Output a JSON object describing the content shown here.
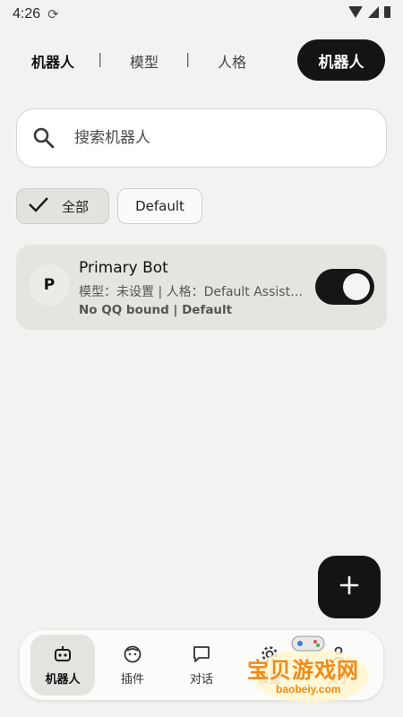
{
  "status_bar": {
    "time": "4:26"
  },
  "top_nav": {
    "tabs": [
      {
        "label": "机器人"
      },
      {
        "label": "模型"
      },
      {
        "label": "人格"
      }
    ],
    "separator": "|",
    "active_pill": "机器人"
  },
  "search": {
    "placeholder": "搜索机器人",
    "value": ""
  },
  "filters": [
    {
      "label": "全部",
      "selected": true
    },
    {
      "label": "Default",
      "selected": false
    }
  ],
  "bots": [
    {
      "avatar_letter": "P",
      "name": "Primary Bot",
      "meta": "模型：未设置 | 人格：Default Assistant",
      "sub": "No QQ bound | Default",
      "enabled": true
    }
  ],
  "fab": {
    "icon": "plus-icon"
  },
  "bottom_nav": [
    {
      "label": "机器人",
      "icon": "robot-icon",
      "active": true
    },
    {
      "label": "插件",
      "icon": "plugin-face-icon",
      "active": false
    },
    {
      "label": "对话",
      "icon": "chat-icon",
      "active": false
    },
    {
      "label": "设置",
      "icon": "gear-icon",
      "active": false
    },
    {
      "label": "关于",
      "icon": "person-icon",
      "active": false
    }
  ],
  "watermark": {
    "text": "宝贝游戏网",
    "url": "baobeiy.com"
  },
  "colors": {
    "background": "#f2f2f0",
    "accent_dark": "#141414",
    "card": "#e4e4e1",
    "watermark": "#f08a1a"
  }
}
